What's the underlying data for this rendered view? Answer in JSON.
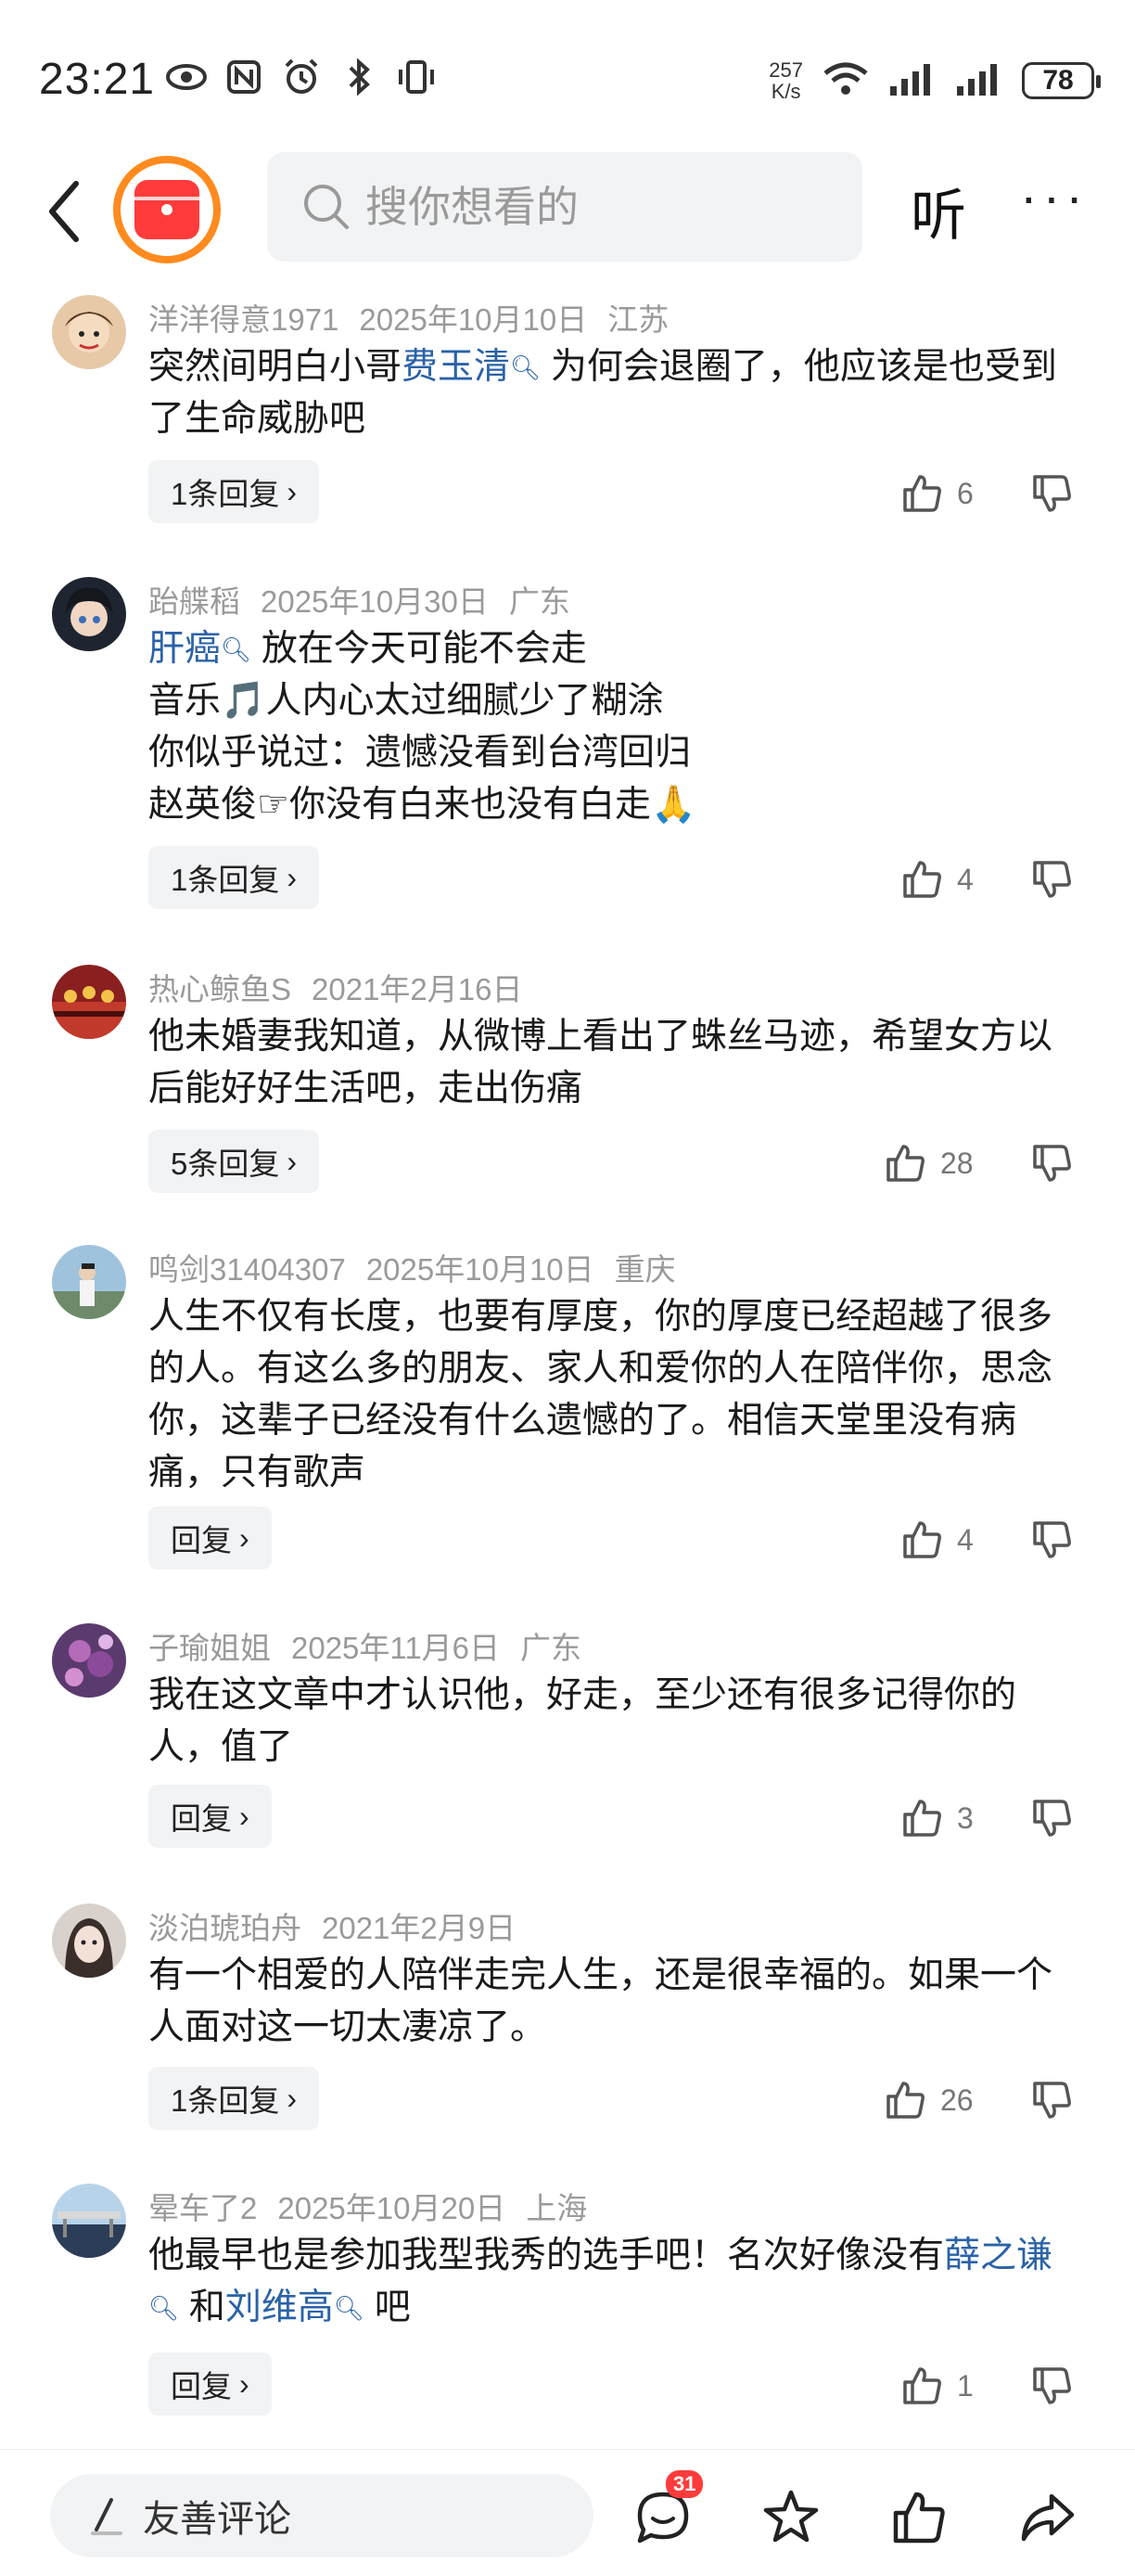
{
  "status_bar": {
    "time": "23:21",
    "net_speed_value": "257",
    "net_speed_unit": "K/s",
    "battery": "78"
  },
  "nav": {
    "search_placeholder": "搜你想看的",
    "listen_label": "听",
    "more_label": "···"
  },
  "comments": [
    {
      "user": "洋洋得意1971",
      "date": "2025年10月10日",
      "location": "江苏",
      "text_parts": [
        "突然间明白小哥",
        "费玉清",
        "为何会退圈了，他应该是也受到了生命威胁吧"
      ],
      "reply_label": "1条回复",
      "likes": "6"
    },
    {
      "user": "跆艓稻",
      "date": "2025年10月30日",
      "location": "广东",
      "text_parts": [
        "肝癌",
        "放在今天可能不会走",
        "音乐🎵人内心太过细腻少了糊涂",
        "你似乎说过：遗憾没看到台湾回归",
        "赵英俊☞你没有白来也没有白走🙏"
      ],
      "reply_label": "1条回复",
      "likes": "4"
    },
    {
      "user": "热心鲸鱼S",
      "date": "2021年2月16日",
      "location": "",
      "text": "他未婚妻我知道，从微博上看出了蛛丝马迹，希望女方以后能好好生活吧，走出伤痛",
      "reply_label": "5条回复",
      "likes": "28"
    },
    {
      "user": "鸣剑31404307",
      "date": "2025年10月10日",
      "location": "重庆",
      "text": "人生不仅有长度，也要有厚度，你的厚度已经超越了很多的人。有这么多的朋友、家人和爱你的人在陪伴你，思念你，这辈子已经没有什么遗憾的了。相信天堂里没有病痛，只有歌声",
      "reply_label": "回复",
      "likes": "4"
    },
    {
      "user": "子瑜姐姐",
      "date": "2025年11月6日",
      "location": "广东",
      "text": "我在这文章中才认识他，好走，至少还有很多记得你的人，值了",
      "reply_label": "回复",
      "likes": "3"
    },
    {
      "user": "淡泊琥珀舟",
      "date": "2021年2月9日",
      "location": "",
      "text": "有一个相爱的人陪伴走完人生，还是很幸福的。如果一个人面对这一切太凄凉了。",
      "reply_label": "1条回复",
      "likes": "26"
    },
    {
      "user": "晕车了2",
      "date": "2025年10月20日",
      "location": "上海",
      "text_parts": [
        "他最早也是参加我型我秀的选手吧！名次好像没有",
        "薛之谦",
        "和",
        "刘维高",
        "吧"
      ],
      "reply_label": "回复",
      "likes": "1"
    }
  ],
  "bottom_bar": {
    "comment_placeholder": "友善评论",
    "comment_badge": "31"
  },
  "colors": {
    "accent_blue": "#2a62a8",
    "logo_orange": "#ff8a1e",
    "logo_red": "#ff3b3b",
    "meta_gray": "#9a9a9a"
  }
}
